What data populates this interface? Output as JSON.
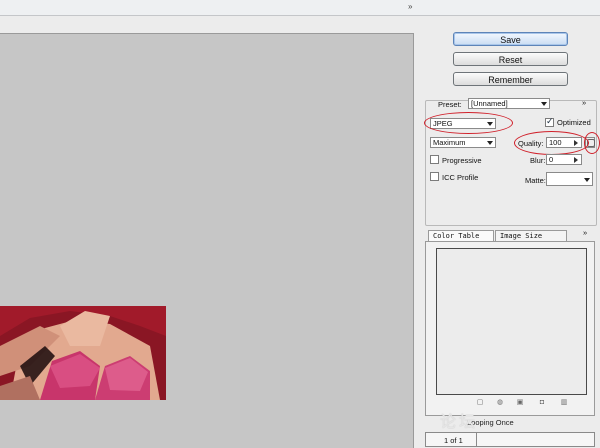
{
  "panel_expand_glyph": "»",
  "buttons": {
    "save": "Save",
    "reset": "Reset",
    "remember": "Remember"
  },
  "settings": {
    "preset_label": "Preset:",
    "preset_value": "[Unnamed]",
    "format_value": "JPEG",
    "optimized_label": "Optimized",
    "optimized_checked": true,
    "quality_level_value": "Maximum",
    "quality_label": "Quality:",
    "quality_value": "100",
    "progressive_label": "Progressive",
    "blur_label": "Blur:",
    "blur_value": "0",
    "icc_label": "ICC Profile",
    "matte_label": "Matte:"
  },
  "tabs": [
    {
      "label": "Color Table",
      "active": true
    },
    {
      "label": "Image Size",
      "active": false
    }
  ],
  "looping_label": "Looping",
  "looping_value": "Once",
  "pager_text": "1 of 1",
  "watermark_text": "论坛",
  "colors": {
    "annotation_red": "#d0202a",
    "preview_gray": "#c6c6c6",
    "primary_button_blue": "#5d84b8"
  }
}
